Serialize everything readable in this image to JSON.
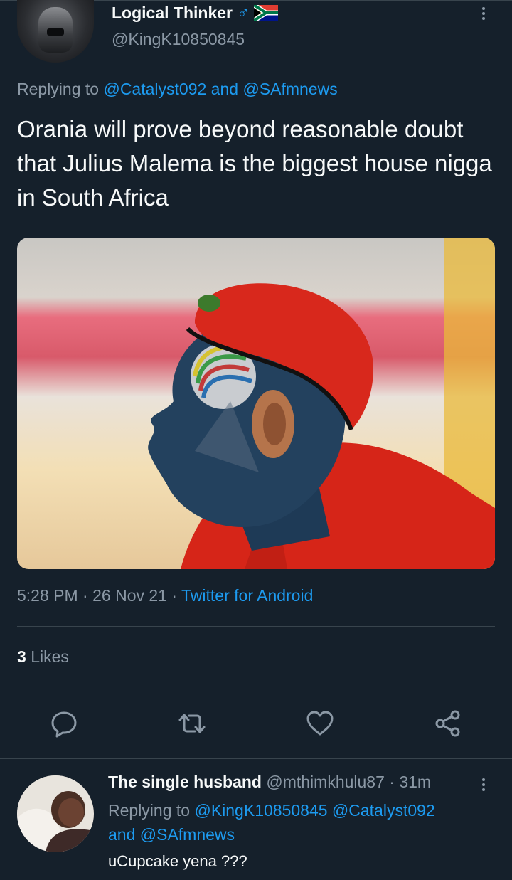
{
  "tweet": {
    "author_name": "Logical Thinker",
    "author_badges": "♂",
    "author_handle": "@KingK10850845",
    "replying_to_prefix": "Replying to",
    "replying_to_user1": "@Catalyst092",
    "replying_to_and": "and",
    "replying_to_user2": "@SAfmnews",
    "text": "Orania will prove beyond reasonable doubt that Julius Malema is the biggest house nigga in South Africa",
    "time": "5:28 PM",
    "date": "26 Nov 21",
    "source": "Twitter for Android",
    "likes_count": "3",
    "likes_label": "Likes"
  },
  "actions": {
    "reply_icon": "reply-icon",
    "retweet_icon": "retweet-icon",
    "like_icon": "heart-icon",
    "share_icon": "share-icon"
  },
  "reply": {
    "author_name": "The single husband",
    "author_handle": "@mthimkhulu87",
    "time_ago": "31m",
    "replying_to_prefix": "Replying to",
    "replying_to_user1": "@KingK10850845",
    "replying_to_user2": "@Catalyst092",
    "replying_to_and": "and",
    "replying_to_user3": "@SAfmnews",
    "text": "uCupcake yena ???"
  },
  "colors": {
    "background": "#15202b",
    "accent": "#1d9bf0",
    "muted_text": "#8b98a5",
    "divider": "#38444d"
  }
}
